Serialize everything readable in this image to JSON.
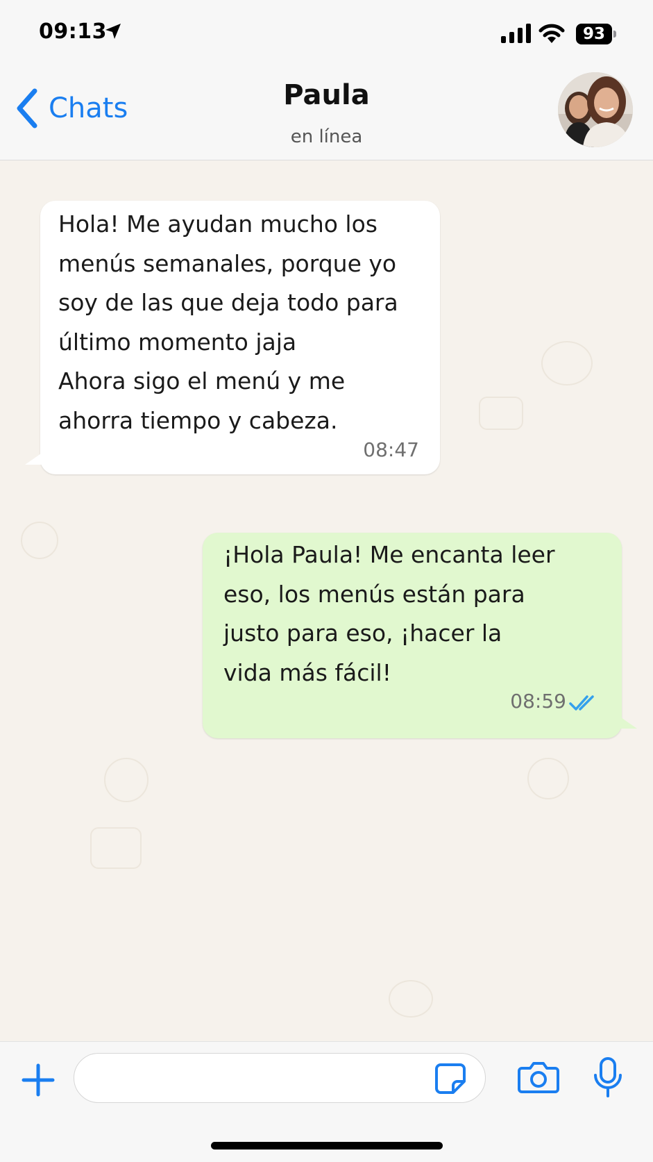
{
  "status_bar": {
    "time": "09:13",
    "battery": "93",
    "icons": [
      "location-arrow-icon",
      "cellular-signal-icon",
      "wifi-icon",
      "battery-icon"
    ]
  },
  "header": {
    "back_label": "Chats",
    "contact_name": "Paula",
    "contact_status": "en línea"
  },
  "messages": [
    {
      "direction": "incoming",
      "text": "Hola! Me ayudan mucho los\nmenús semanales, porque yo\nsoy de las que deja todo para\núltimo momento jaja\nAhora sigo el menú y me\nahorra tiempo y cabeza.",
      "time": "08:47"
    },
    {
      "direction": "outgoing",
      "text": "¡Hola Paula! Me encanta leer\neso, los menús están para\njusto para eso, ¡hacer la\nvida más fácil!",
      "time": "08:59",
      "status": "read"
    }
  ],
  "input_bar": {
    "icons": [
      "plus-icon",
      "sticker-icon",
      "camera-icon",
      "microphone-icon"
    ]
  },
  "colors": {
    "accent": "#1a7ef0",
    "outgoing_bubble": "#e1f8cf",
    "incoming_bubble": "#ffffff",
    "chat_background": "#f6f2ec",
    "read_ticks": "#34a0ec"
  }
}
